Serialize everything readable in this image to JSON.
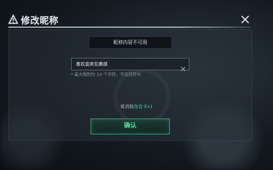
{
  "header": {
    "title": "修改昵称",
    "title_icon": "warning-triangle-icon",
    "close_icon": "close-icon"
  },
  "dialog": {
    "notice_text": "昵称内容不可用",
    "nickname_input": {
      "value": "喜欢直男包裹感",
      "clear_icon": "clear-x-icon"
    },
    "hint_text": "* 最大限制为 14 个字符，不支持符号",
    "cost": {
      "prefix": "将消耗",
      "item": "改名卡x1"
    },
    "confirm_label": "确认"
  },
  "colors": {
    "accent": "#3ccb91",
    "confirm_border": "#2e9e72",
    "background": "#141a20"
  }
}
